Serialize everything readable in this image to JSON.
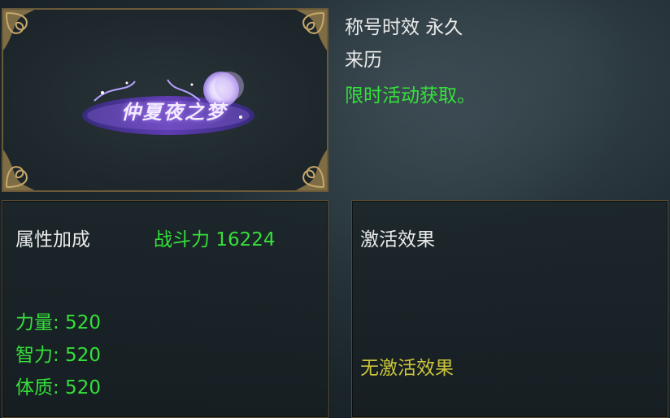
{
  "title_card": {
    "emblem_text": "仲夏夜之梦"
  },
  "info": {
    "duration": "称号时效 永久",
    "source_label": "来历",
    "source_value": "限时活动获取。"
  },
  "attributes_panel": {
    "title": "属性加成",
    "power": "战斗力 16224",
    "stats": [
      "力量: 520",
      "智力: 520",
      "体质: 520"
    ]
  },
  "effect_panel": {
    "title": "激活效果",
    "value": "无激活效果"
  },
  "colors": {
    "green": "#35e03a",
    "yellow": "#c9c43a",
    "white": "#eaeaea",
    "frame_gold": "#8a7448"
  },
  "icons": [
    "ornate-corner-icon",
    "moon-emblem-icon"
  ]
}
